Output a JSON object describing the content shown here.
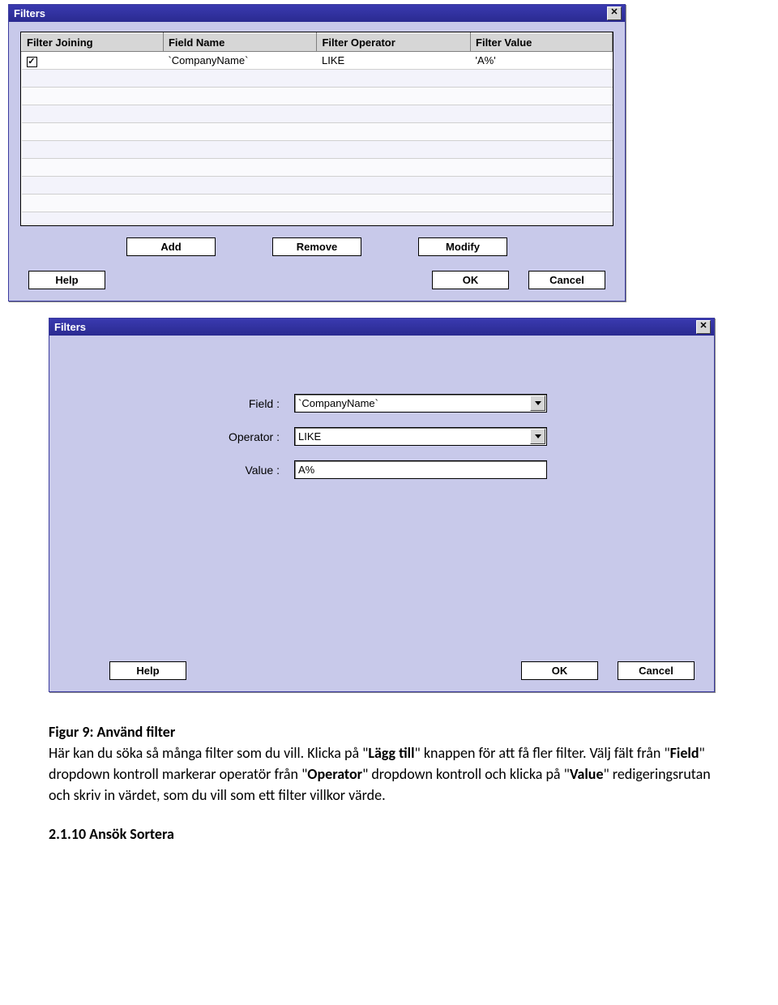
{
  "dialog1": {
    "title": "Filters",
    "columns": [
      "Filter Joining",
      "Field Name",
      "Filter Operator",
      "Filter Value"
    ],
    "row": {
      "checked": "✓",
      "field_name": "`CompanyName`",
      "operator": "LIKE",
      "value": "'A%'"
    },
    "buttons": {
      "add": "Add",
      "remove": "Remove",
      "modify": "Modify"
    },
    "footer": {
      "help": "Help",
      "ok": "OK",
      "cancel": "Cancel"
    }
  },
  "dialog2": {
    "title": "Filters",
    "labels": {
      "field": "Field :",
      "operator": "Operator :",
      "value": "Value :"
    },
    "values": {
      "field": "`CompanyName`",
      "operator": "LIKE",
      "value": "A%"
    },
    "footer": {
      "help": "Help",
      "ok": "OK",
      "cancel": "Cancel"
    }
  },
  "caption": {
    "title": "Figur 9: Använd filter",
    "seg1": "Här kan du söka så många filter som du vill. Klicka på \"",
    "b1": "Lägg till",
    "seg2": "\" knappen för att få fler filter. Välj fält från \"",
    "b2": "Field",
    "seg3": "\" dropdown kontroll markerar operatör från \"",
    "b3": "Operator",
    "seg4": "\" dropdown kontroll och klicka på \"",
    "b4": "Value",
    "seg5": "\" redigeringsrutan och skriv in värdet, som du vill som ett filter villkor värde."
  },
  "section": "2.1.10 Ansök Sortera"
}
